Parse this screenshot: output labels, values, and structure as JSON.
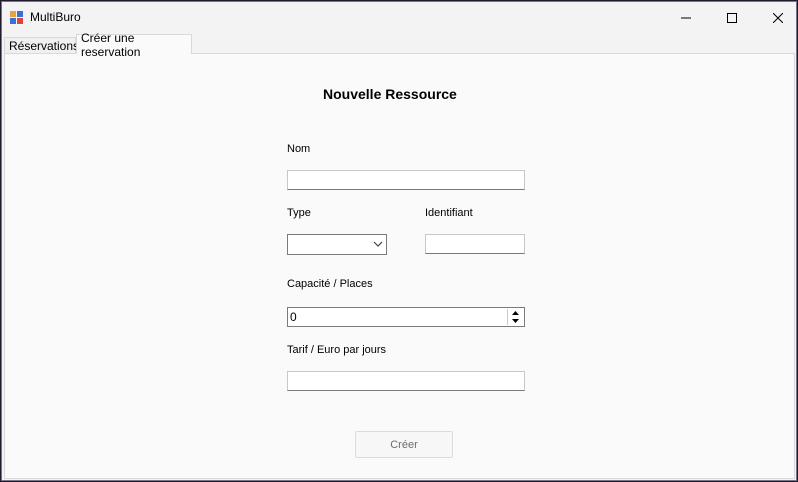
{
  "window": {
    "title": "MultiBuro",
    "controls": [
      "minimize-icon",
      "maximize-icon",
      "close-icon"
    ]
  },
  "tabs": [
    {
      "label": "Réservations",
      "active": false
    },
    {
      "label": "Créer une reservation",
      "active": true
    }
  ],
  "form": {
    "heading": "Nouvelle Ressource",
    "nom_label": "Nom",
    "nom_value": "",
    "type_label": "Type",
    "type_value": "",
    "identifiant_label": "Identifiant",
    "identifiant_value": "",
    "capacite_label": "Capacité / Places",
    "capacite_value": "0",
    "tarif_label": "Tarif / Euro par jours",
    "tarif_value": "",
    "create_button": "Créer",
    "create_button_enabled": false
  }
}
